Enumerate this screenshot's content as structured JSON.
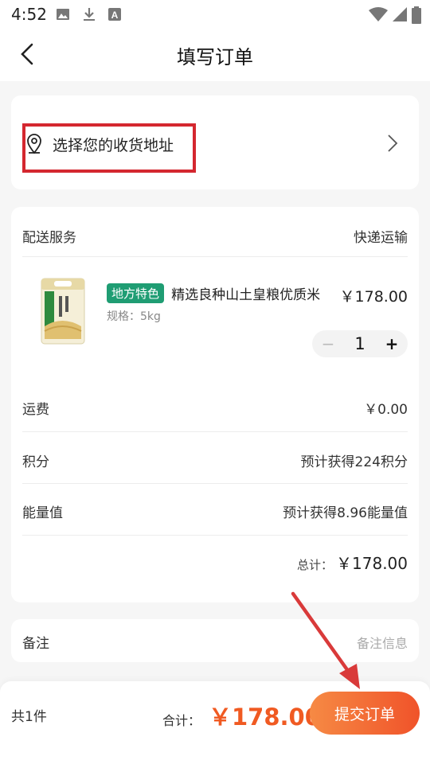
{
  "status_bar": {
    "time": "4:52"
  },
  "header": {
    "title": "填写订单"
  },
  "address": {
    "label": "选择您的收货地址"
  },
  "order": {
    "delivery_label": "配送服务",
    "delivery_value": "快递运输",
    "product": {
      "tag": "地方特色",
      "name": "精选良种山土皇粮优质米",
      "spec": "规格：5kg",
      "price": "￥178.00",
      "qty": "1",
      "minus": "−",
      "plus": "+"
    },
    "shipping_label": "运费",
    "shipping_value": "￥0.00",
    "points_label": "积分",
    "points_value": "预计获得224积分",
    "energy_label": "能量值",
    "energy_value": "预计获得8.96能量值",
    "total_label": "总计：",
    "total_value": "￥178.00"
  },
  "remark": {
    "label": "备注",
    "placeholder": "备注信息"
  },
  "bottom": {
    "count": "共1件",
    "sum_label": "合计：",
    "sum_value": "￥178.00",
    "submit": "提交订单"
  },
  "colors": {
    "accent": "#f05a22",
    "tag_green": "#1f9d73",
    "highlight_red": "#d4272f"
  }
}
